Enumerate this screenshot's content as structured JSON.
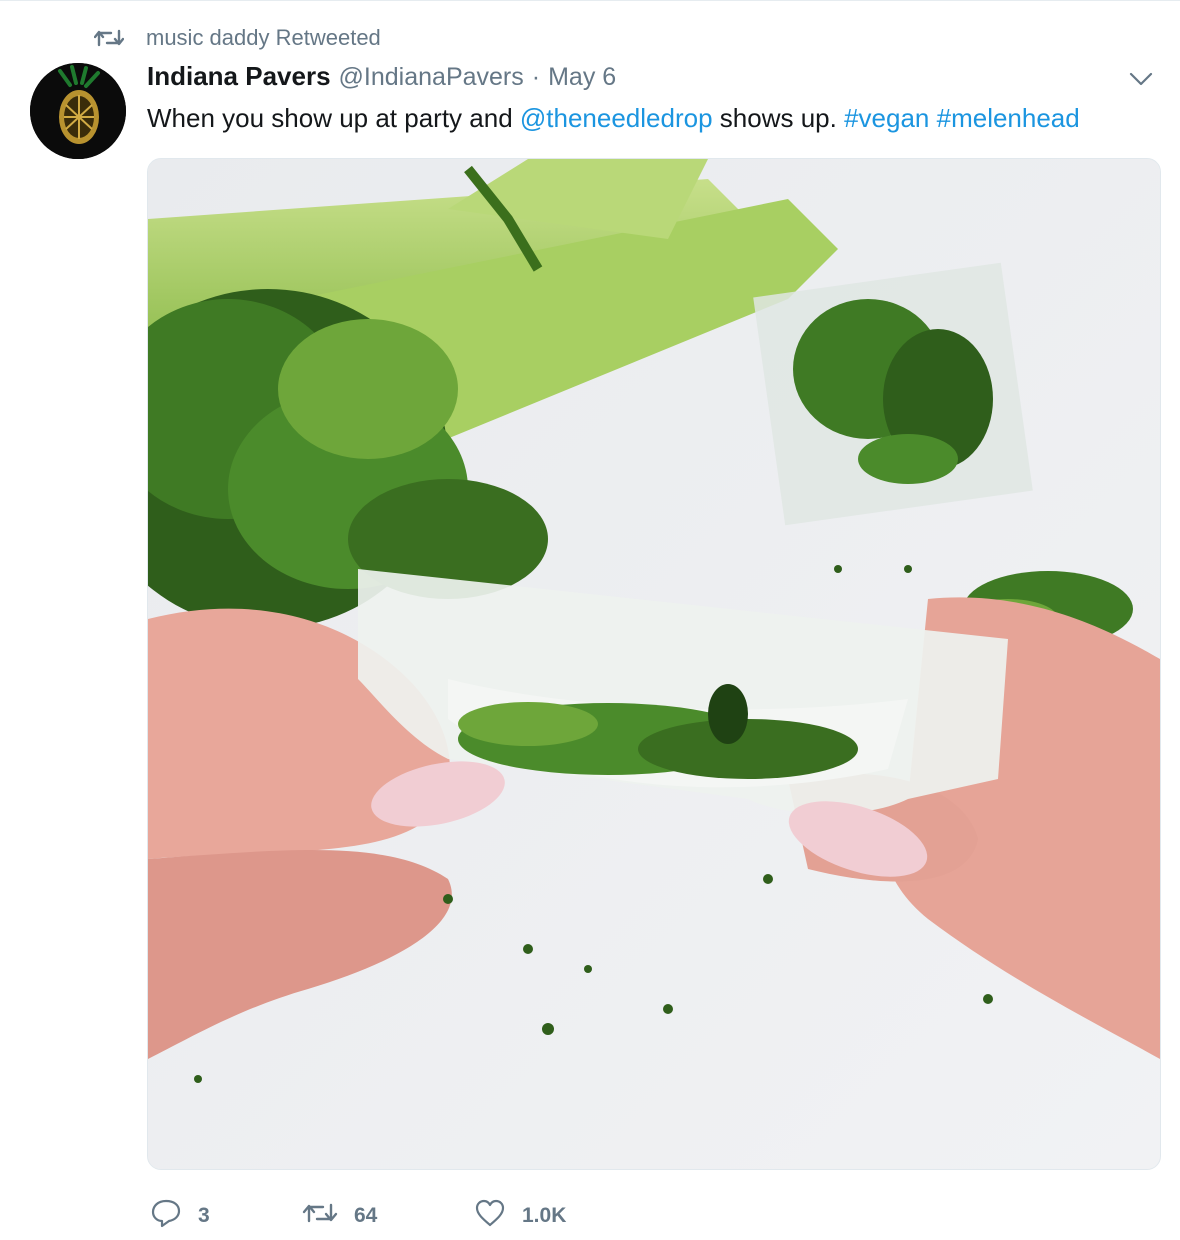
{
  "retweet_context": {
    "icon": "retweet-icon",
    "text": "music daddy Retweeted"
  },
  "tweet": {
    "author_name": "Indiana Pavers",
    "author_handle": "@IndianaPavers",
    "separator": "·",
    "date": "May 6",
    "text_parts": {
      "t1": "When you show up at party and ",
      "mention": "@theneedledrop",
      "t2": " shows up. ",
      "hashtag1": "#vegan",
      "space": " ",
      "hashtag2": "#melenhead"
    },
    "link_color": "#1b95e0",
    "media_icon": "photo-image"
  },
  "actions": {
    "reply": {
      "icon": "reply-icon",
      "count": "3"
    },
    "retweet": {
      "icon": "retweet-icon",
      "count": "64"
    },
    "like": {
      "icon": "heart-icon",
      "count": "1.0K"
    }
  },
  "colors": {
    "text_primary": "#14171a",
    "text_secondary": "#657786",
    "accent": "#1b95e0"
  }
}
